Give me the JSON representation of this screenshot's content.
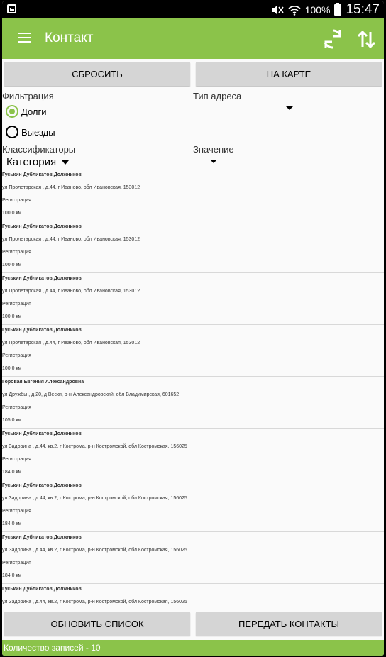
{
  "status_bar": {
    "battery": "100%",
    "time": "15:47",
    "icons": [
      "screenshot-icon",
      "mute-icon",
      "wifi-icon",
      "battery-icon"
    ]
  },
  "app_bar": {
    "title": "Контакт",
    "icons": [
      "menu-icon",
      "sync-icon",
      "sort-icon"
    ]
  },
  "buttons": {
    "reset": "СБРОСИТЬ",
    "map": "НА КАРТЕ",
    "refresh": "ОБНОВИТЬ СПИСОК",
    "send": "ПЕРЕДАТЬ КОНТАКТЫ"
  },
  "filters": {
    "filter_label": "Фильтрация",
    "address_type_label": "Тип адреса",
    "option_debts": "Долги",
    "option_visits": "Выезды",
    "selected": "Долги",
    "classifiers_label": "Классификаторы",
    "value_label": "Значение",
    "category": "Категория"
  },
  "items": [
    {
      "name": "Гуськин Дубликатов Должников",
      "address": "ул Пролетарская , д.44, г Иваново, обл Ивановская, 153012",
      "type": "Регистрация",
      "distance": "100.0 км"
    },
    {
      "name": "Гуськин Дубликатов Должников",
      "address": "ул Пролетарская , д.44, г Иваново, обл Ивановская, 153012",
      "type": "Регистрация",
      "distance": "100.0 км"
    },
    {
      "name": "Гуськин Дубликатов Должников",
      "address": "ул Пролетарская , д.44, г Иваново, обл Ивановская, 153012",
      "type": "Регистрация",
      "distance": "100.0 км"
    },
    {
      "name": "Гуськин Дубликатов Должников",
      "address": "ул Пролетарская , д.44, г Иваново, обл Ивановская, 153012",
      "type": "Регистрация",
      "distance": "100.0 км"
    },
    {
      "name": "Горовая Евгения Александровна",
      "address": "ул Дружбы , д.20, д Вески, р-н Александровский, обл Владимирская, 601652",
      "type": "Регистрация",
      "distance": "105.0 км"
    },
    {
      "name": "Гуськин Дубликатов Должников",
      "address": "ул Задорина , д.44, кв.2, г Кострома, р-н Костромской, обл Костромская, 156025",
      "type": "Регистрация",
      "distance": "184.0 км"
    },
    {
      "name": "Гуськин Дубликатов Должников",
      "address": "ул Задорина , д.44, кв.2, г Кострома, р-н Костромской, обл Костромская, 156025",
      "type": "Регистрация",
      "distance": "184.0 км"
    },
    {
      "name": "Гуськин Дубликатов Должников",
      "address": "ул Задорина , д.44, кв.2, г Кострома, р-н Костромской, обл Костромская, 156025",
      "type": "Регистрация",
      "distance": "184.0 км"
    },
    {
      "name": "Гуськин Дубликатов Должников",
      "address": "ул Задорина , д.44, кв.2, г Кострома, р-н Костромской, обл Костромская, 156025",
      "type": "",
      "distance": ""
    }
  ],
  "footer": {
    "count_text": "Количество записей - 10"
  },
  "colors": {
    "accent": "#8bc34a",
    "button_bg": "#d5d5d5",
    "background": "#fafafa"
  }
}
